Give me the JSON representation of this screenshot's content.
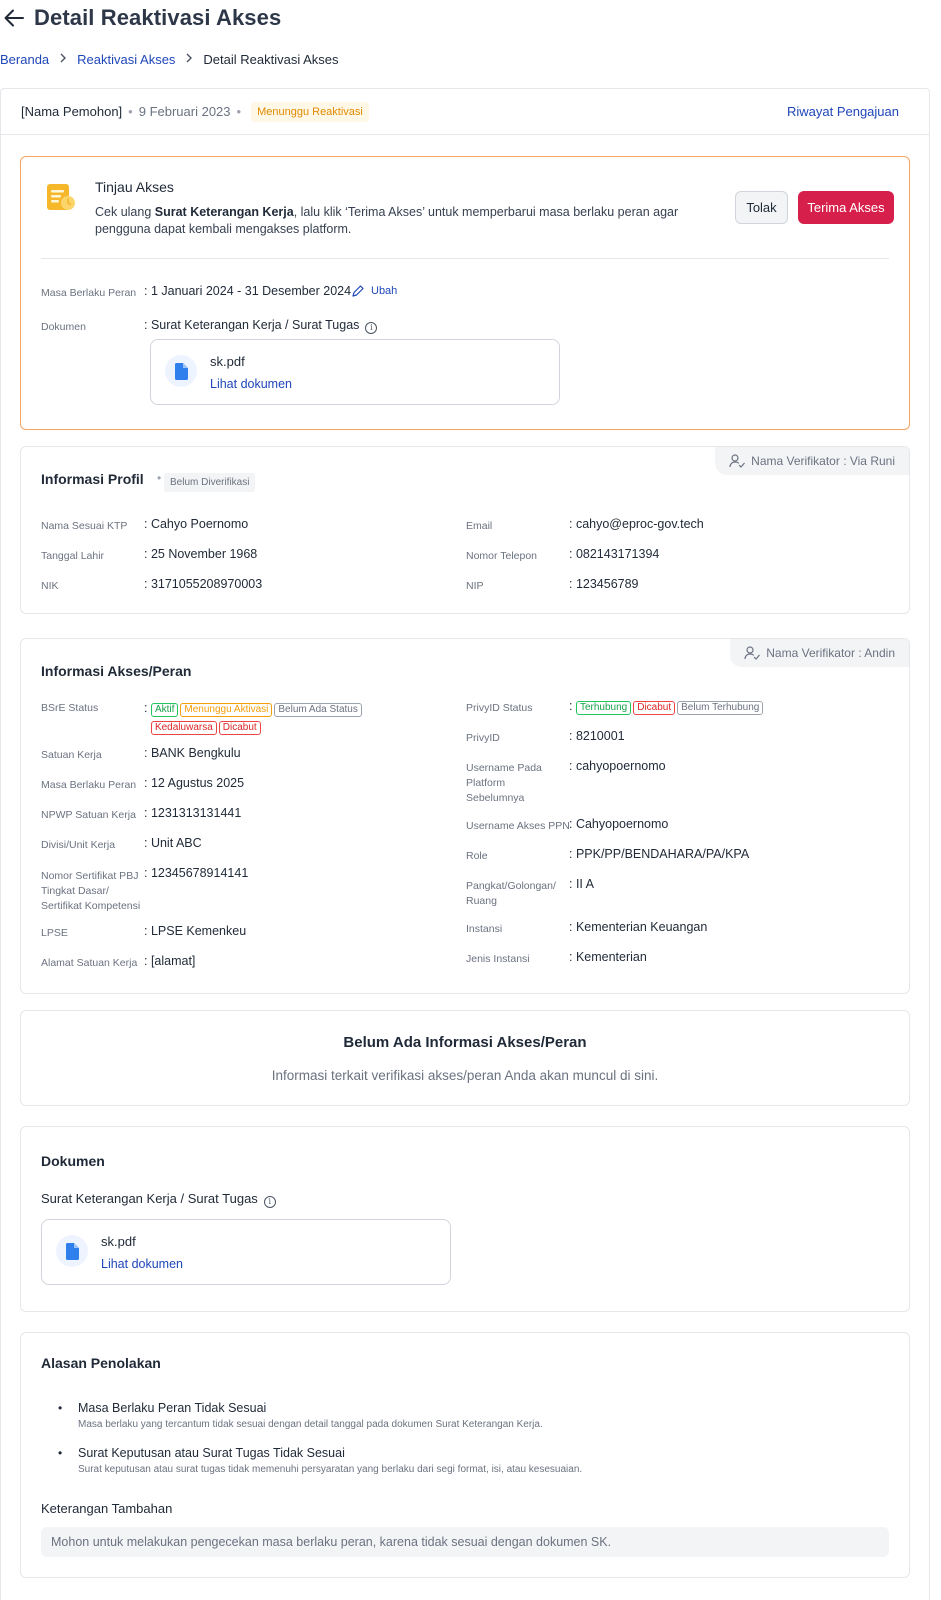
{
  "header": {
    "title": "Detail Reaktivasi Akses"
  },
  "breadcrumb": {
    "home": "Beranda",
    "parent": "Reaktivasi Akses",
    "current": "Detail Reaktivasi Akses"
  },
  "topbar": {
    "applicant": "[Nama Pemohon]",
    "date": "9 Februari 2023",
    "status": "Menunggu Reaktivasi",
    "history_link": "Riwayat Pengajuan"
  },
  "review": {
    "title": "Tinjau Akses",
    "desc_prefix": "Cek ulang ",
    "desc_bold": "Surat Keterangan Kerja",
    "desc_suffix": ", lalu klik ‘Terima Akses’ untuk memperbarui masa berlaku peran agar pengguna dapat kembali mengakses platform.",
    "reject_label": "Tolak",
    "accept_label": "Terima Akses",
    "period_label": "Masa Berlaku Peran",
    "period_value": ": 1 Januari 2024 - 31 Desember 2024",
    "edit_label": "Ubah",
    "doc_label": "Dokumen",
    "doc_value": ": Surat Keterangan Kerja / Surat Tugas",
    "file_name": "sk.pdf",
    "file_link": "Lihat dokumen"
  },
  "profile": {
    "verifier": "Nama Verifikator : Via Runi",
    "title": "Informasi Profil",
    "badge": "Belum Diverifikasi",
    "left": [
      {
        "label": "Nama Sesuai KTP",
        "value": ": Cahyo Poernomo"
      },
      {
        "label": "Tanggal Lahir",
        "value": ": 25 November 1968"
      },
      {
        "label": "NIK",
        "value": ": 3171055208970003"
      }
    ],
    "right": [
      {
        "label": "Email",
        "value": ": cahyo@eproc-gov.tech"
      },
      {
        "label": "Nomor Telepon",
        "value": ": 082143171394"
      },
      {
        "label": "NIP",
        "value": ": 123456789"
      }
    ]
  },
  "access": {
    "verifier": "Nama Verifikator : Andin",
    "title": "Informasi Akses/Peran",
    "bsre_label": "BSrE Status",
    "bsre_chips": [
      "Aktif",
      "Menunggu Aktivasi",
      "Belum Ada Status",
      "Kedaluwarsa",
      "Dicabut"
    ],
    "privy_label": "PrivyID Status",
    "privy_chips": [
      "Terhubung",
      "Dicabut",
      "Belum Terhubung"
    ],
    "left": [
      {
        "label": "Satuan Kerja",
        "value": ": BANK Bengkulu"
      },
      {
        "label": "Masa Berlaku Peran",
        "value": ": 12 Agustus 2025"
      },
      {
        "label": "NPWP Satuan Kerja",
        "value": ": 1231313131441"
      },
      {
        "label": "Divisi/Unit Kerja",
        "value": ": Unit ABC"
      },
      {
        "label": "Nomor Sertifikat PBJ Tingkat Dasar/ Sertifikat Kompetensi",
        "value": ": 12345678914141"
      },
      {
        "label": "LPSE",
        "value": ": LPSE Kemenkeu"
      },
      {
        "label": "Alamat Satuan Kerja",
        "value": ": [alamat]"
      }
    ],
    "right": [
      {
        "label": "PrivyID",
        "value": ": 8210001"
      },
      {
        "label": "Username Pada Platform Sebelumnya",
        "value": ": cahyopoernomo"
      },
      {
        "label": "Username Akses PPN",
        "value": ": Cahyopoernomo"
      },
      {
        "label": "Role",
        "value": ": PPK/PP/BENDAHARA/PA/KPA"
      },
      {
        "label": "Pangkat/Golongan/ Ruang",
        "value": ": II A"
      },
      {
        "label": "Instansi",
        "value": ": Kementerian Keuangan"
      },
      {
        "label": "Jenis Instansi",
        "value": ": Kementerian"
      }
    ]
  },
  "empty": {
    "title": "Belum Ada Informasi Akses/Peran",
    "desc": "Informasi terkait verifikasi akses/peran Anda akan muncul di sini."
  },
  "documents": {
    "title": "Dokumen",
    "doc_type": "Surat Keterangan Kerja / Surat Tugas",
    "file_name": "sk.pdf",
    "file_link": "Lihat dokumen"
  },
  "rejection": {
    "title": "Alasan Penolakan",
    "reasons": [
      {
        "title": "Masa Berlaku Peran Tidak Sesuai",
        "desc": "Masa berlaku yang tercantum tidak sesuai dengan detail tanggal pada dokumen Surat Keterangan Kerja."
      },
      {
        "title": "Surat Keputusan atau Surat Tugas Tidak Sesuai",
        "desc": "Surat keputusan atau surat tugas tidak memenuhi persyaratan yang berlaku dari segi format, isi, atau kesesuaian."
      }
    ],
    "note_label": "Keterangan Tambahan",
    "note_value": "Mohon untuk melakukan pengecekan masa berlaku peran, karena tidak sesuai dengan dokumen SK."
  }
}
